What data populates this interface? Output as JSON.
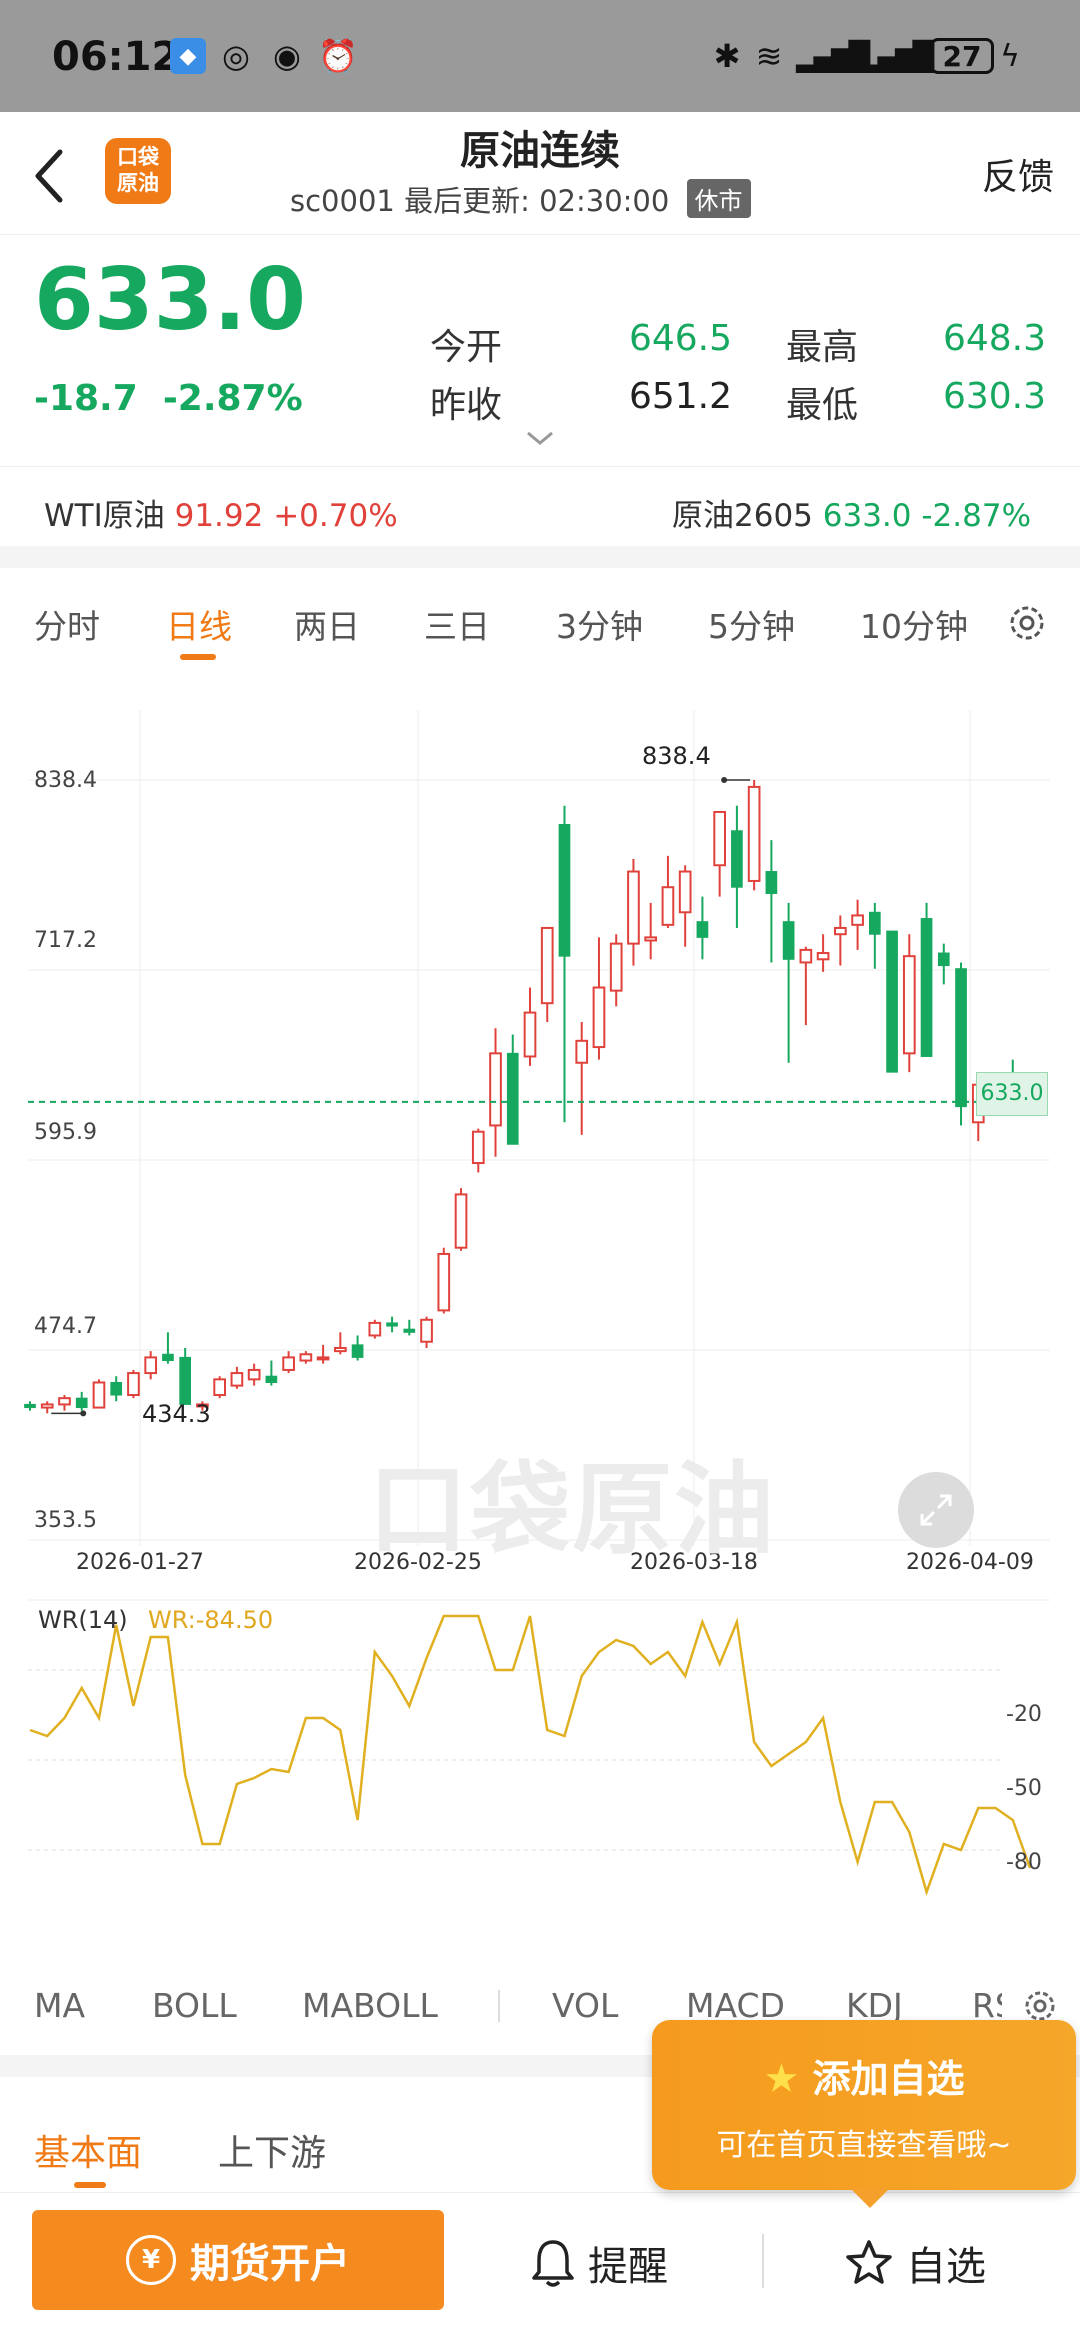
{
  "status": {
    "time": "06:12",
    "battery": "27"
  },
  "header": {
    "title": "原油连续",
    "code": "sc0001",
    "update_label": "最后更新:",
    "update_time": "02:30:00",
    "market_state": "休市",
    "logo_top": "口袋",
    "logo_bottom": "原油",
    "feedback": "反馈"
  },
  "quote": {
    "price": "633.0",
    "change": "-18.7",
    "change_pct": "-2.87%",
    "open_label": "今开",
    "open": "646.5",
    "high_label": "最高",
    "high": "648.3",
    "prev_close_label": "昨收",
    "prev_close": "651.2",
    "low_label": "最低",
    "low": "630.3"
  },
  "tickers": {
    "wti_name": "WTI原油",
    "wti_price": "91.92",
    "wti_pct": "+0.70%",
    "sc_name": "原油2605",
    "sc_price": "633.0",
    "sc_pct": "-2.87%"
  },
  "tabs": [
    "分时",
    "日线",
    "两日",
    "三日",
    "3分钟",
    "5分钟",
    "10分钟"
  ],
  "active_tab": "日线",
  "colors": {
    "up": "#e0423b",
    "down": "#16a85e",
    "accent": "#f07a16",
    "wr_line": "#e0b020"
  },
  "chart_data": [
    {
      "type": "candlestick",
      "y_ticks": [
        "838.4",
        "717.2",
        "595.9",
        "474.7",
        "353.5"
      ],
      "ylim": [
        353.5,
        838.4
      ],
      "x_ticks": [
        "2026-01-27",
        "2026-02-25",
        "2026-03-18",
        "2026-04-09"
      ],
      "max_label": "838.4",
      "min_label": "434.3",
      "last_price_label": "633.0",
      "candles": [
        [
          440,
          442,
          436,
          438
        ],
        [
          438,
          442,
          434.3,
          440
        ],
        [
          440,
          446,
          436,
          444
        ],
        [
          444,
          448,
          436,
          438
        ],
        [
          438,
          456,
          438,
          454
        ],
        [
          454,
          458,
          442,
          446
        ],
        [
          446,
          462,
          444,
          460
        ],
        [
          460,
          474,
          456,
          470
        ],
        [
          472,
          486,
          466,
          468
        ],
        [
          470,
          476,
          440,
          440
        ],
        [
          440,
          442,
          436,
          440
        ],
        [
          446,
          458,
          444,
          456
        ],
        [
          452,
          464,
          450,
          460
        ],
        [
          456,
          466,
          452,
          462
        ],
        [
          458,
          468,
          452,
          454
        ],
        [
          462,
          474,
          460,
          470
        ],
        [
          468,
          474,
          466,
          472
        ],
        [
          470,
          478,
          466,
          470
        ],
        [
          474,
          486,
          472,
          476
        ],
        [
          478,
          484,
          468,
          470
        ],
        [
          484,
          494,
          482,
          492
        ],
        [
          492,
          496,
          486,
          490
        ],
        [
          488,
          494,
          484,
          486
        ],
        [
          480,
          496,
          476,
          494
        ],
        [
          500,
          540,
          498,
          536
        ],
        [
          540,
          578,
          538,
          574
        ],
        [
          594,
          616,
          588,
          614
        ],
        [
          618,
          680,
          598,
          664
        ],
        [
          664,
          676,
          606,
          606
        ],
        [
          662,
          706,
          656,
          690
        ],
        [
          696,
          744,
          684,
          744
        ],
        [
          810,
          822,
          620,
          726
        ],
        [
          658,
          684,
          612,
          672
        ],
        [
          668,
          738,
          660,
          706
        ],
        [
          704,
          740,
          694,
          734
        ],
        [
          734,
          788,
          720,
          780
        ],
        [
          736,
          760,
          724,
          738
        ],
        [
          746,
          790,
          744,
          770
        ],
        [
          754,
          784,
          732,
          780
        ],
        [
          748,
          764,
          724,
          738
        ],
        [
          784,
          814,
          764,
          818
        ],
        [
          806,
          822,
          744,
          770
        ],
        [
          774,
          838.4,
          768,
          834
        ],
        [
          780,
          800,
          722,
          766
        ],
        [
          748,
          760,
          658,
          724
        ],
        [
          722,
          732,
          682,
          730
        ],
        [
          724,
          740,
          716,
          728
        ],
        [
          740,
          752,
          720,
          744
        ],
        [
          746,
          762,
          730,
          752
        ],
        [
          754,
          760,
          718,
          740
        ],
        [
          742,
          742,
          654,
          652
        ],
        [
          664,
          740,
          652,
          726
        ],
        [
          750,
          760,
          662,
          662
        ],
        [
          728,
          734,
          708,
          720
        ],
        [
          718,
          722,
          618,
          630
        ],
        [
          620,
          644,
          608,
          644
        ],
        [
          640,
          650,
          640,
          648
        ],
        [
          648,
          660,
          636,
          640
        ],
        [
          646,
          648,
          630.3,
          633
        ]
      ],
      "candles_note": "open, high, low, close per trading day"
    },
    {
      "type": "line",
      "title": "WR(14)",
      "value_label": "WR:-84.50",
      "y_ticks": [
        "-20",
        "-50",
        "-80"
      ],
      "ylim": [
        -100,
        0
      ],
      "values": [
        -40,
        -42,
        -36,
        -26,
        -36,
        -5,
        -32,
        -9,
        -9,
        -55,
        -78,
        -78,
        -58,
        -56,
        -53,
        -54,
        -36,
        -36,
        -40,
        -70,
        -14,
        -22,
        -32,
        -16,
        -2,
        -2,
        -2,
        -20,
        -20,
        -2,
        -40,
        -42,
        -22,
        -14,
        -10,
        -12,
        -18,
        -14,
        -22,
        -4,
        -18,
        -4,
        -44,
        -52,
        -48,
        -44,
        -36,
        -64,
        -84,
        -64,
        -64,
        -74,
        -94,
        -78,
        -80,
        -66,
        -66,
        -70,
        -86
      ]
    }
  ],
  "wr": {
    "label": "WR(14)",
    "value": "WR:-84.50"
  },
  "indicators": [
    "MA",
    "BOLL",
    "MABOLL",
    "VOL",
    "MACD",
    "KDJ",
    "RS"
  ],
  "bottom_tabs": {
    "fundamental": "基本面",
    "chain": "上下游"
  },
  "tooltip": {
    "title": "添加自选",
    "body": "可在首页直接查看哦~"
  },
  "bottom": {
    "open_account": "期货开户",
    "yen": "¥",
    "remind": "提醒",
    "watchlist": "自选"
  },
  "watermark": "口袋原油"
}
